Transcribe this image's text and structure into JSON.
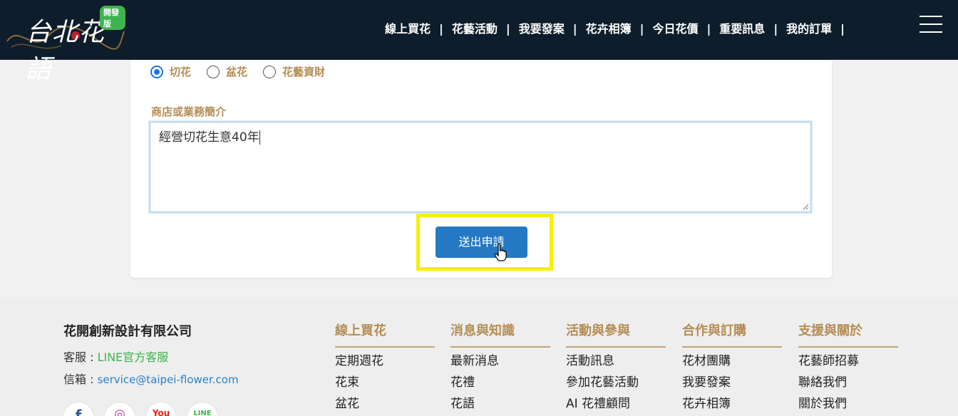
{
  "header": {
    "logo_text": "台北花語",
    "logo_badge": "開發版",
    "nav": [
      "線上買花",
      "花藝活動",
      "我要發案",
      "花卉相簿",
      "今日花價",
      "重要訊息",
      "我的訂單"
    ],
    "nav_separator": "|"
  },
  "form": {
    "radio_options": [
      {
        "label": "切花",
        "checked": true
      },
      {
        "label": "盆花",
        "checked": false
      },
      {
        "label": "花藝資財",
        "checked": false
      }
    ],
    "description_label": "商店或業務簡介",
    "description_value": "經營切花生意40年",
    "submit_label": "送出申請"
  },
  "footer": {
    "company": "花開創新設計有限公司",
    "service_prefix": "客服 : ",
    "service_link": "LINE官方客服",
    "email_prefix": "信箱 : ",
    "email_link": "service@taipei-flower.com",
    "socials": [
      {
        "icon": "facebook-icon",
        "glyph": "f",
        "color": "#3b5998"
      },
      {
        "icon": "instagram-icon",
        "glyph": "◎",
        "color": "#c13584"
      },
      {
        "icon": "youtube-icon",
        "glyph": "You",
        "color": "#e62117"
      },
      {
        "icon": "line-icon",
        "glyph": "LINE",
        "color": "#3bb54a"
      }
    ],
    "columns": [
      {
        "title": "線上買花",
        "links": [
          "定期週花",
          "花束",
          "盆花"
        ]
      },
      {
        "title": "消息與知識",
        "links": [
          "最新消息",
          "花禮",
          "花語"
        ]
      },
      {
        "title": "活動與參與",
        "links": [
          "活動訊息",
          "參加花藝活動",
          "AI 花禮顧問"
        ]
      },
      {
        "title": "合作與訂購",
        "links": [
          "花材團購",
          "我要發案",
          "花卉相簿"
        ]
      },
      {
        "title": "支援與關於",
        "links": [
          "花藝師招募",
          "聯絡我們",
          "關於我們"
        ]
      }
    ]
  },
  "colors": {
    "header_bg": "#0e1d2b",
    "accent_gold": "#b58d55",
    "button_blue": "#2579c3",
    "highlight_yellow": "#f5f000"
  }
}
